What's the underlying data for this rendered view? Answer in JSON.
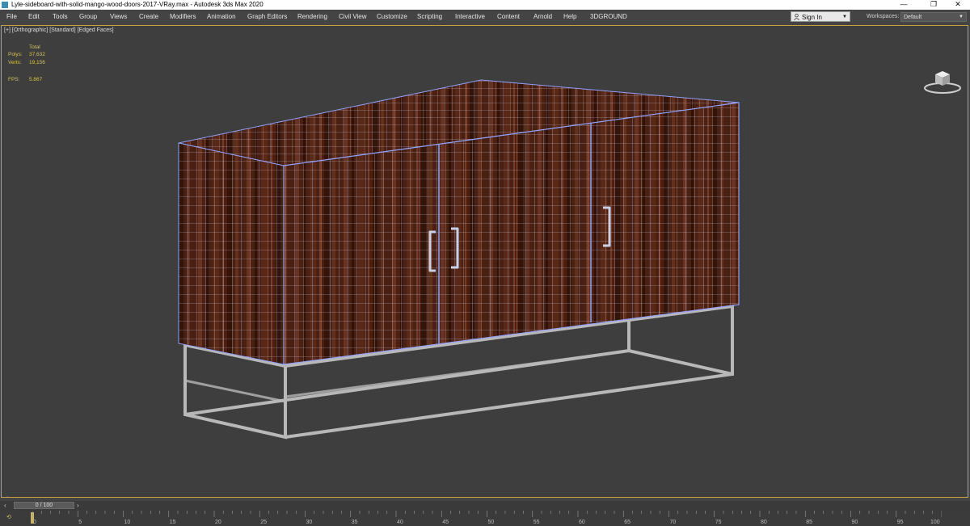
{
  "window": {
    "title": "Lyle-sideboard-with-solid-mango-wood-doors-2017-VRay.max - Autodesk 3ds Max 2020",
    "controls": [
      "—",
      "❐",
      "✕"
    ]
  },
  "menu": [
    "File",
    "Edit",
    "Tools",
    "Group",
    "Views",
    "Create",
    "Modifiers",
    "Animation",
    "Graph Editors",
    "Rendering",
    "Civil View",
    "Customize",
    "Scripting",
    "Interactive",
    "Content",
    "Arnold",
    "Help",
    "3DGROUND"
  ],
  "signin": {
    "label": "Sign In"
  },
  "workspaces": {
    "label": "Workspaces:",
    "value": "Default"
  },
  "viewport": {
    "label": "[+] [Orthographic] [Standard] [Edged Faces]",
    "stats": {
      "total_label": "Total",
      "polys_label": "Polys:",
      "polys_value": "37,632",
      "verts_label": "Verts:",
      "verts_value": "19,156",
      "fps_label": "FPS:",
      "fps_value": "5.867"
    }
  },
  "timeline": {
    "frame_display": "0 / 100",
    "current_frame": 0,
    "total_frames": 100,
    "ticks": [
      "0",
      "5",
      "10",
      "15",
      "20",
      "25",
      "30",
      "35",
      "40",
      "45",
      "50",
      "55",
      "60",
      "65",
      "70",
      "75",
      "80",
      "85",
      "90",
      "95",
      "100"
    ]
  },
  "colors": {
    "viewport_border": "#caa13e",
    "stats_text": "#d9c24a",
    "wire": "#8fa3ff",
    "wood_dark": "#3a1a0e",
    "wood_light": "#6b3220",
    "metal": "#b8b8b8"
  }
}
